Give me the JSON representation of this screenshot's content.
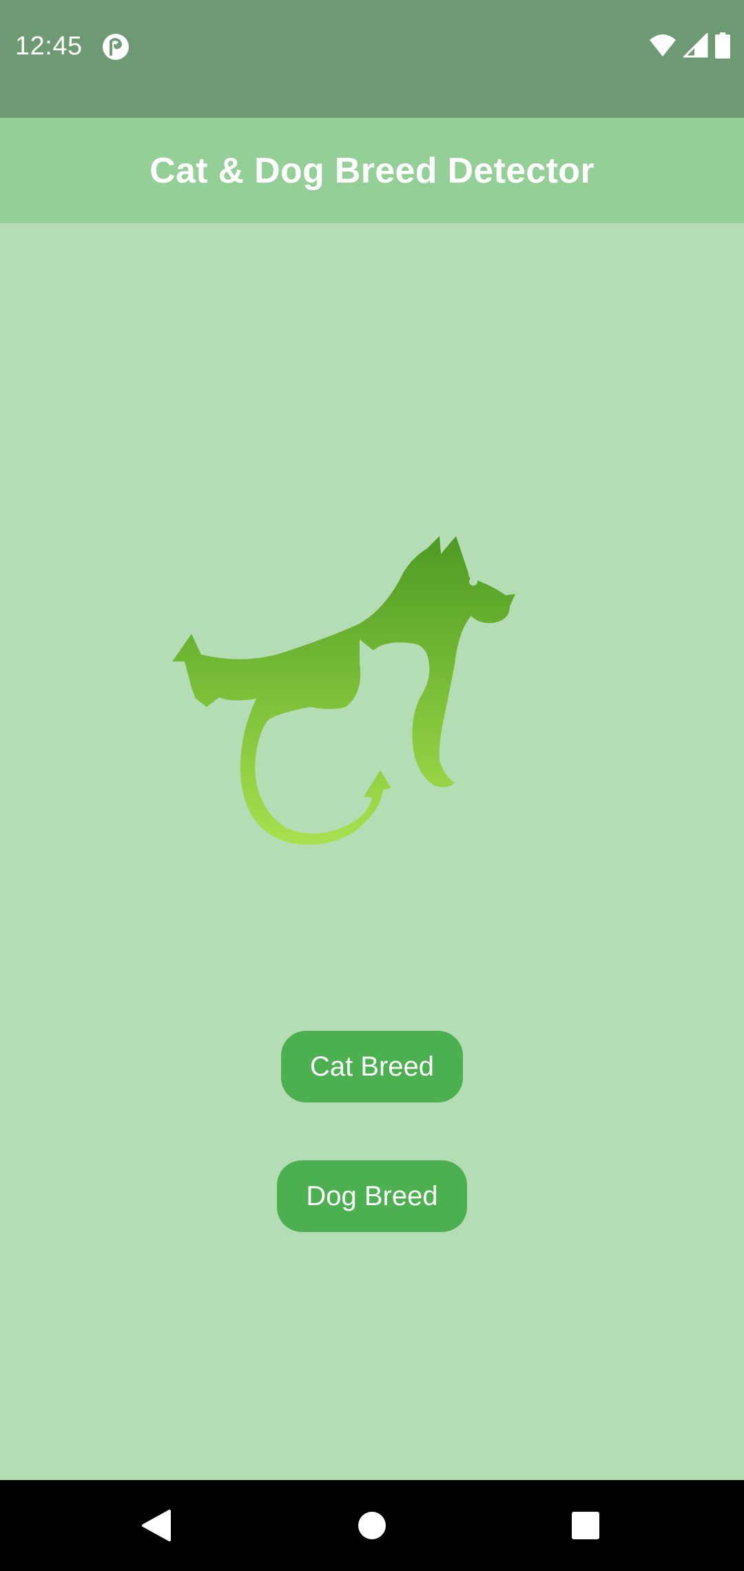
{
  "status_bar": {
    "time": "12:45",
    "icons": [
      "app-notification-icon",
      "wifi-icon",
      "cellular-signal-icon",
      "battery-icon"
    ]
  },
  "app_bar": {
    "title": "Cat & Dog Breed Detector"
  },
  "main": {
    "logo_icon": "cat-dog-silhouette-icon",
    "buttons": [
      {
        "label": "Cat Breed"
      },
      {
        "label": "Dog Breed"
      }
    ]
  },
  "nav_bar": {
    "icons": [
      "back-icon",
      "home-icon",
      "recents-icon"
    ]
  },
  "colors": {
    "status_bar": "#6d9a72",
    "app_bar": "#93cf96",
    "background": "#b4ddb5",
    "button": "#4caf50",
    "logo_top": "#4e9a23",
    "logo_bottom": "#a8e04e"
  }
}
